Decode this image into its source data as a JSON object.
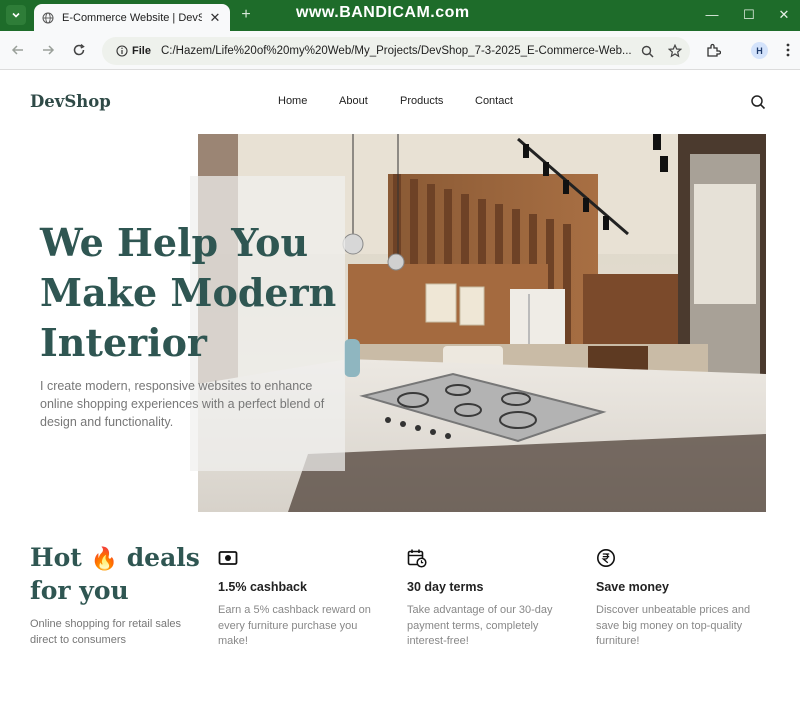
{
  "browser": {
    "tab_title": "E-Commerce Website | DevShop",
    "watermark": "www.BANDICAM.com",
    "url_chip": "File",
    "url": "C:/Hazem/Life%20of%20my%20Web/My_Projects/DevShop_7-3-2025_E-Commerce-Web...",
    "profile_initial": "H",
    "theme_color": "#1e6c2a"
  },
  "site": {
    "logo": "DevShop",
    "nav": [
      "Home",
      "About",
      "Products",
      "Contact"
    ],
    "hero": {
      "title_lines": [
        "We Help You",
        "Make Modern",
        "Interior"
      ],
      "subtitle": "I create modern, responsive websites to enhance online shopping experiences with a perfect blend of design and functionality."
    },
    "deals": {
      "title_part1": "Hot",
      "emoji": "🔥",
      "title_part2": "deals",
      "title_line2": "for you",
      "subtitle": "Online shopping for retail sales direct to consumers"
    },
    "features": [
      {
        "icon": "cash-icon",
        "title": "1.5% cashback",
        "desc": "Earn a 5% cashback reward on every furniture purchase you make!"
      },
      {
        "icon": "calendar-clock-icon",
        "title": "30 day terms",
        "desc": "Take advantage of our 30-day payment terms, completely interest-free!"
      },
      {
        "icon": "rupee-icon",
        "title": "Save money",
        "desc": "Discover unbeatable prices and save big money on top-quality furniture!"
      }
    ],
    "colors": {
      "heading": "#2f5652",
      "logo": "#2f4a47",
      "muted": "#777777"
    }
  }
}
